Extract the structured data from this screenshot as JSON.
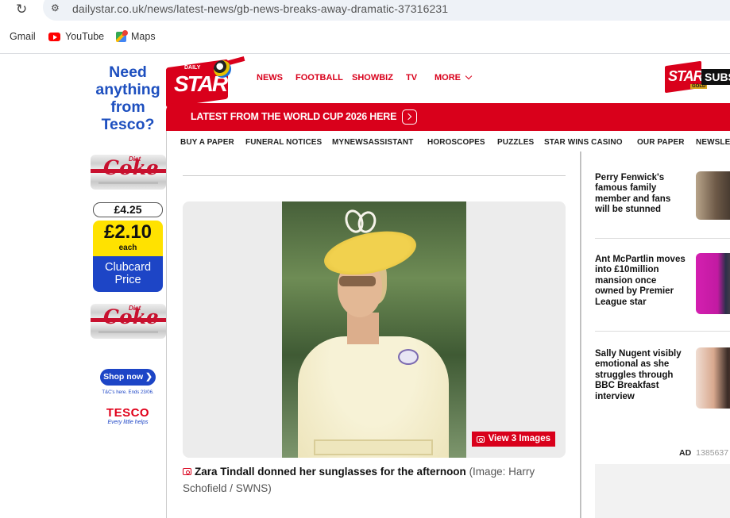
{
  "browser": {
    "url": "dailystar.co.uk/news/latest-news/gb-news-breaks-away-dramatic-37316231",
    "bookmarks": [
      {
        "label": "Gmail"
      },
      {
        "label": "YouTube"
      },
      {
        "label": "Maps"
      }
    ]
  },
  "ad_left": {
    "headline_lines": [
      "Need",
      "anything",
      "from",
      "Tesco?"
    ],
    "coke_logo": "Coke",
    "coke_diet": "Diet",
    "old_price": "£4.25",
    "new_price": "£2.10",
    "each": "each",
    "clubcard_lines": [
      "Clubcard",
      "Price"
    ],
    "shop_label": "Shop now ❯",
    "terms": "T&C's here. Ends 23/06.",
    "brand": "TESCO",
    "strapline": "Every little helps"
  },
  "header": {
    "logo_small": "DAILY",
    "logo_main": "STAR",
    "nav": [
      "NEWS",
      "FOOTBALL",
      "SHOWBIZ",
      "TV",
      "MORE"
    ],
    "gold_logo": "STAR",
    "gold_tag": "GOLD",
    "gold_cta": "SUBSC"
  },
  "banner": {
    "text": "LATEST FROM THE WORLD CUP 2026 HERE"
  },
  "subnav": [
    "BUY A PAPER",
    "FUNERAL NOTICES",
    "MYNEWSASSISTANT",
    "HOROSCOPES",
    "PUZZLES",
    "STAR WINS CASINO",
    "OUR PAPER",
    "NEWSLET"
  ],
  "article": {
    "gallery_label": "View 3 Images",
    "caption_bold": "Zara Tindall donned her sunglasses for the afternoon",
    "caption_credit": " (Image: Harry Schofield / SWNS)"
  },
  "sidebar": {
    "stories": [
      {
        "title": "Perry Fenwick's famous family member and fans will be stunned"
      },
      {
        "title": "Ant McPartlin moves into £10million mansion once owned by Premier League star"
      },
      {
        "title": "Sally Nugent visibly emotional as she struggles through BBC Breakfast interview"
      }
    ],
    "ad_label": "AD",
    "ad_id": "1385637"
  }
}
